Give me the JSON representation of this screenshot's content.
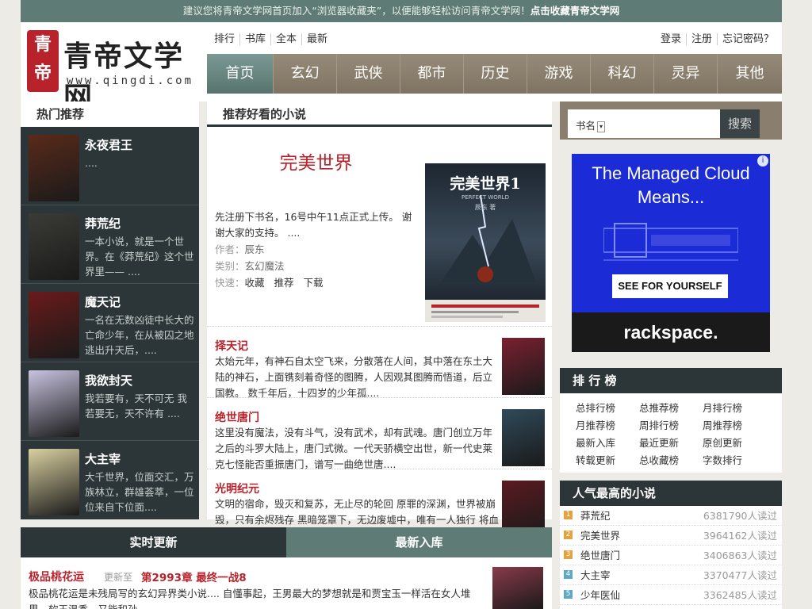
{
  "topbar": {
    "text": "建议您将青帝文学网首页加入“浏览器收藏夹”，以便能够轻松访问青帝文学网！",
    "link": "点击收藏青帝文学网"
  },
  "logo": {
    "seal": "青帝",
    "name": "青帝文学网",
    "url": "www.qingdi.com"
  },
  "subnav": [
    "排行",
    "书库",
    "全本",
    "最新"
  ],
  "usernav": [
    "登录",
    "注册",
    "忘记密码？"
  ],
  "mainnav": [
    "首页",
    "玄幻",
    "武侠",
    "都市",
    "历史",
    "游戏",
    "科幻",
    "灵异",
    "其他"
  ],
  "hot": {
    "title": "热门推荐",
    "items": [
      {
        "name": "永夜君王",
        "desc": "....",
        "color": "#5a2a1a"
      },
      {
        "name": "莽荒纪",
        "desc": "一本小说，就是一个世界。在《莽荒纪》这个世界里——  ....",
        "color": "#3b3b36"
      },
      {
        "name": "魔天记",
        "desc": "一名在无数凶徒中长大的亡命少年，在从被囚之地逃出升天后，....",
        "color": "#6a1a1a"
      },
      {
        "name": "我欲封天",
        "desc": "我若要有，天不可无 我若要无，天不许有 ....",
        "color": "#c9c3e0"
      },
      {
        "name": "大主宰",
        "desc": "大千世界，位面交汇，万族林立，群雄荟萃，一位位来自下位面....",
        "color": "#d9d0a0"
      }
    ]
  },
  "rec": {
    "title": "推荐好看的小说",
    "feature": {
      "name": "完美世界",
      "desc": "先注册下书名，16号中午11点正式上传。 谢谢大家的支持。 ....",
      "author_label": "作者：",
      "author": "辰东",
      "cat_label": "类别：",
      "cat": "玄幻魔法",
      "quick_label": "快速：",
      "actions": [
        "收藏",
        "推荐",
        "下载"
      ],
      "cover_title": "完美世界1",
      "cover_sub": "PERFECT WORLD",
      "cover_author": "辰东 著"
    },
    "items": [
      {
        "name": "择天记",
        "desc": "太始元年，有神石自太空飞来，分散落在人间，其中落在东土大陆的神石，上面镌刻着奇怪的图腾，人因观其图腾而悟道，后立国教。 数千年后，十四岁的少年孤....",
        "color": "#7a2030"
      },
      {
        "name": "绝世唐门",
        "desc": "这里没有魔法，没有斗气，没有武术，却有武魂。唐门创立万年之后的斗罗大陆上，唐门式微。一代天骄横空出世，新一代史莱克七怪能否重振唐门，谱写一曲绝世唐....",
        "color": "#2f4a5a"
      },
      {
        "name": "光明纪元",
        "desc": "文明的宿命，毁灭和复苏，无止尽的轮回 原罪的深渊，世界被崩毁，只有余烬残存 黑暗笼罩下，无边废墟中，唯有一人独行 将血罪消泯，摧破那黑幕，....",
        "color": "#5a1a20"
      }
    ]
  },
  "search": {
    "select": "书名",
    "placeholder": "",
    "button": "搜索"
  },
  "ad": {
    "headline": "The Managed Cloud Means...",
    "cta": "SEE FOR YOURSELF",
    "brand": "rackspace.",
    "info": "i"
  },
  "rank": {
    "title": "排 行 榜",
    "links": [
      "总排行榜",
      "总推荐榜",
      "月排行榜",
      "月推荐榜",
      "周排行榜",
      "周推荐榜",
      "最新入库",
      "最近更新",
      "原创更新",
      "转载更新",
      "总收藏榜",
      "字数排行"
    ]
  },
  "pop": {
    "title": "人气最高的小说",
    "items": [
      {
        "num": "1",
        "name": "莽荒纪",
        "count": "6381790人读过",
        "color": "#e6a23c"
      },
      {
        "num": "2",
        "name": "完美世界",
        "count": "3964162人读过",
        "color": "#e6a23c"
      },
      {
        "num": "3",
        "name": "绝世唐门",
        "count": "3406863人读过",
        "color": "#e6a23c"
      },
      {
        "num": "4",
        "name": "大主宰",
        "count": "3370477人读过",
        "color": "#5fa8c8"
      },
      {
        "num": "5",
        "name": "少年医仙",
        "count": "3362485人读过",
        "color": "#5fa8c8"
      }
    ]
  },
  "updates": {
    "tabs": [
      "实时更新",
      "最新入库"
    ],
    "item": {
      "name": "极品桃花运",
      "label": "更新至",
      "chapter": "第2993章 最终一战8",
      "desc": "极品桃花运是未残局写的玄幻异界类小说.... 自懂事起，王男最大的梦想就是和贾宝玉一样活在女人堆里，软玉温香，又能和孙",
      "color": "#8a3a4a"
    }
  }
}
